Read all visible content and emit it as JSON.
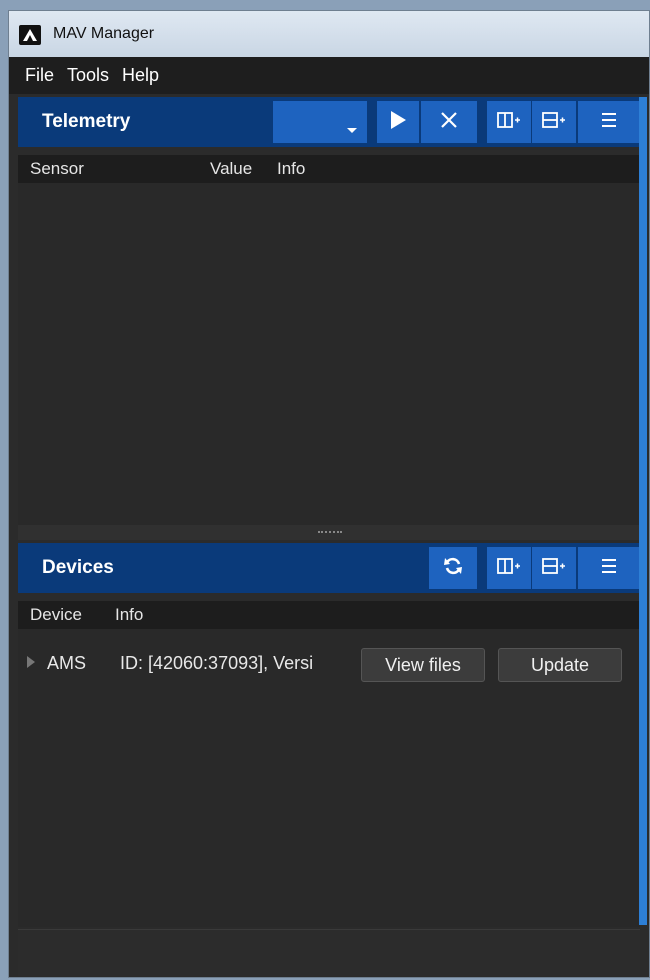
{
  "window": {
    "title": "MAV Manager"
  },
  "menu": [
    {
      "label": "File"
    },
    {
      "label": "Tools"
    },
    {
      "label": "Help"
    }
  ],
  "telemetry": {
    "title": "Telemetry",
    "columns": [
      "Sensor",
      "Value",
      "Info"
    ]
  },
  "devices": {
    "title": "Devices",
    "columns": [
      "Device",
      "Info"
    ],
    "rows": [
      {
        "device": "AMS",
        "info": "ID: [42060:37093], Versi",
        "view_label": "View files",
        "update_label": "Update"
      }
    ]
  },
  "colors": {
    "header_bg": "#0a3a7a",
    "button_bg": "#1e63bf",
    "panel_bg": "#292929",
    "accent": "#2d7fd6"
  }
}
